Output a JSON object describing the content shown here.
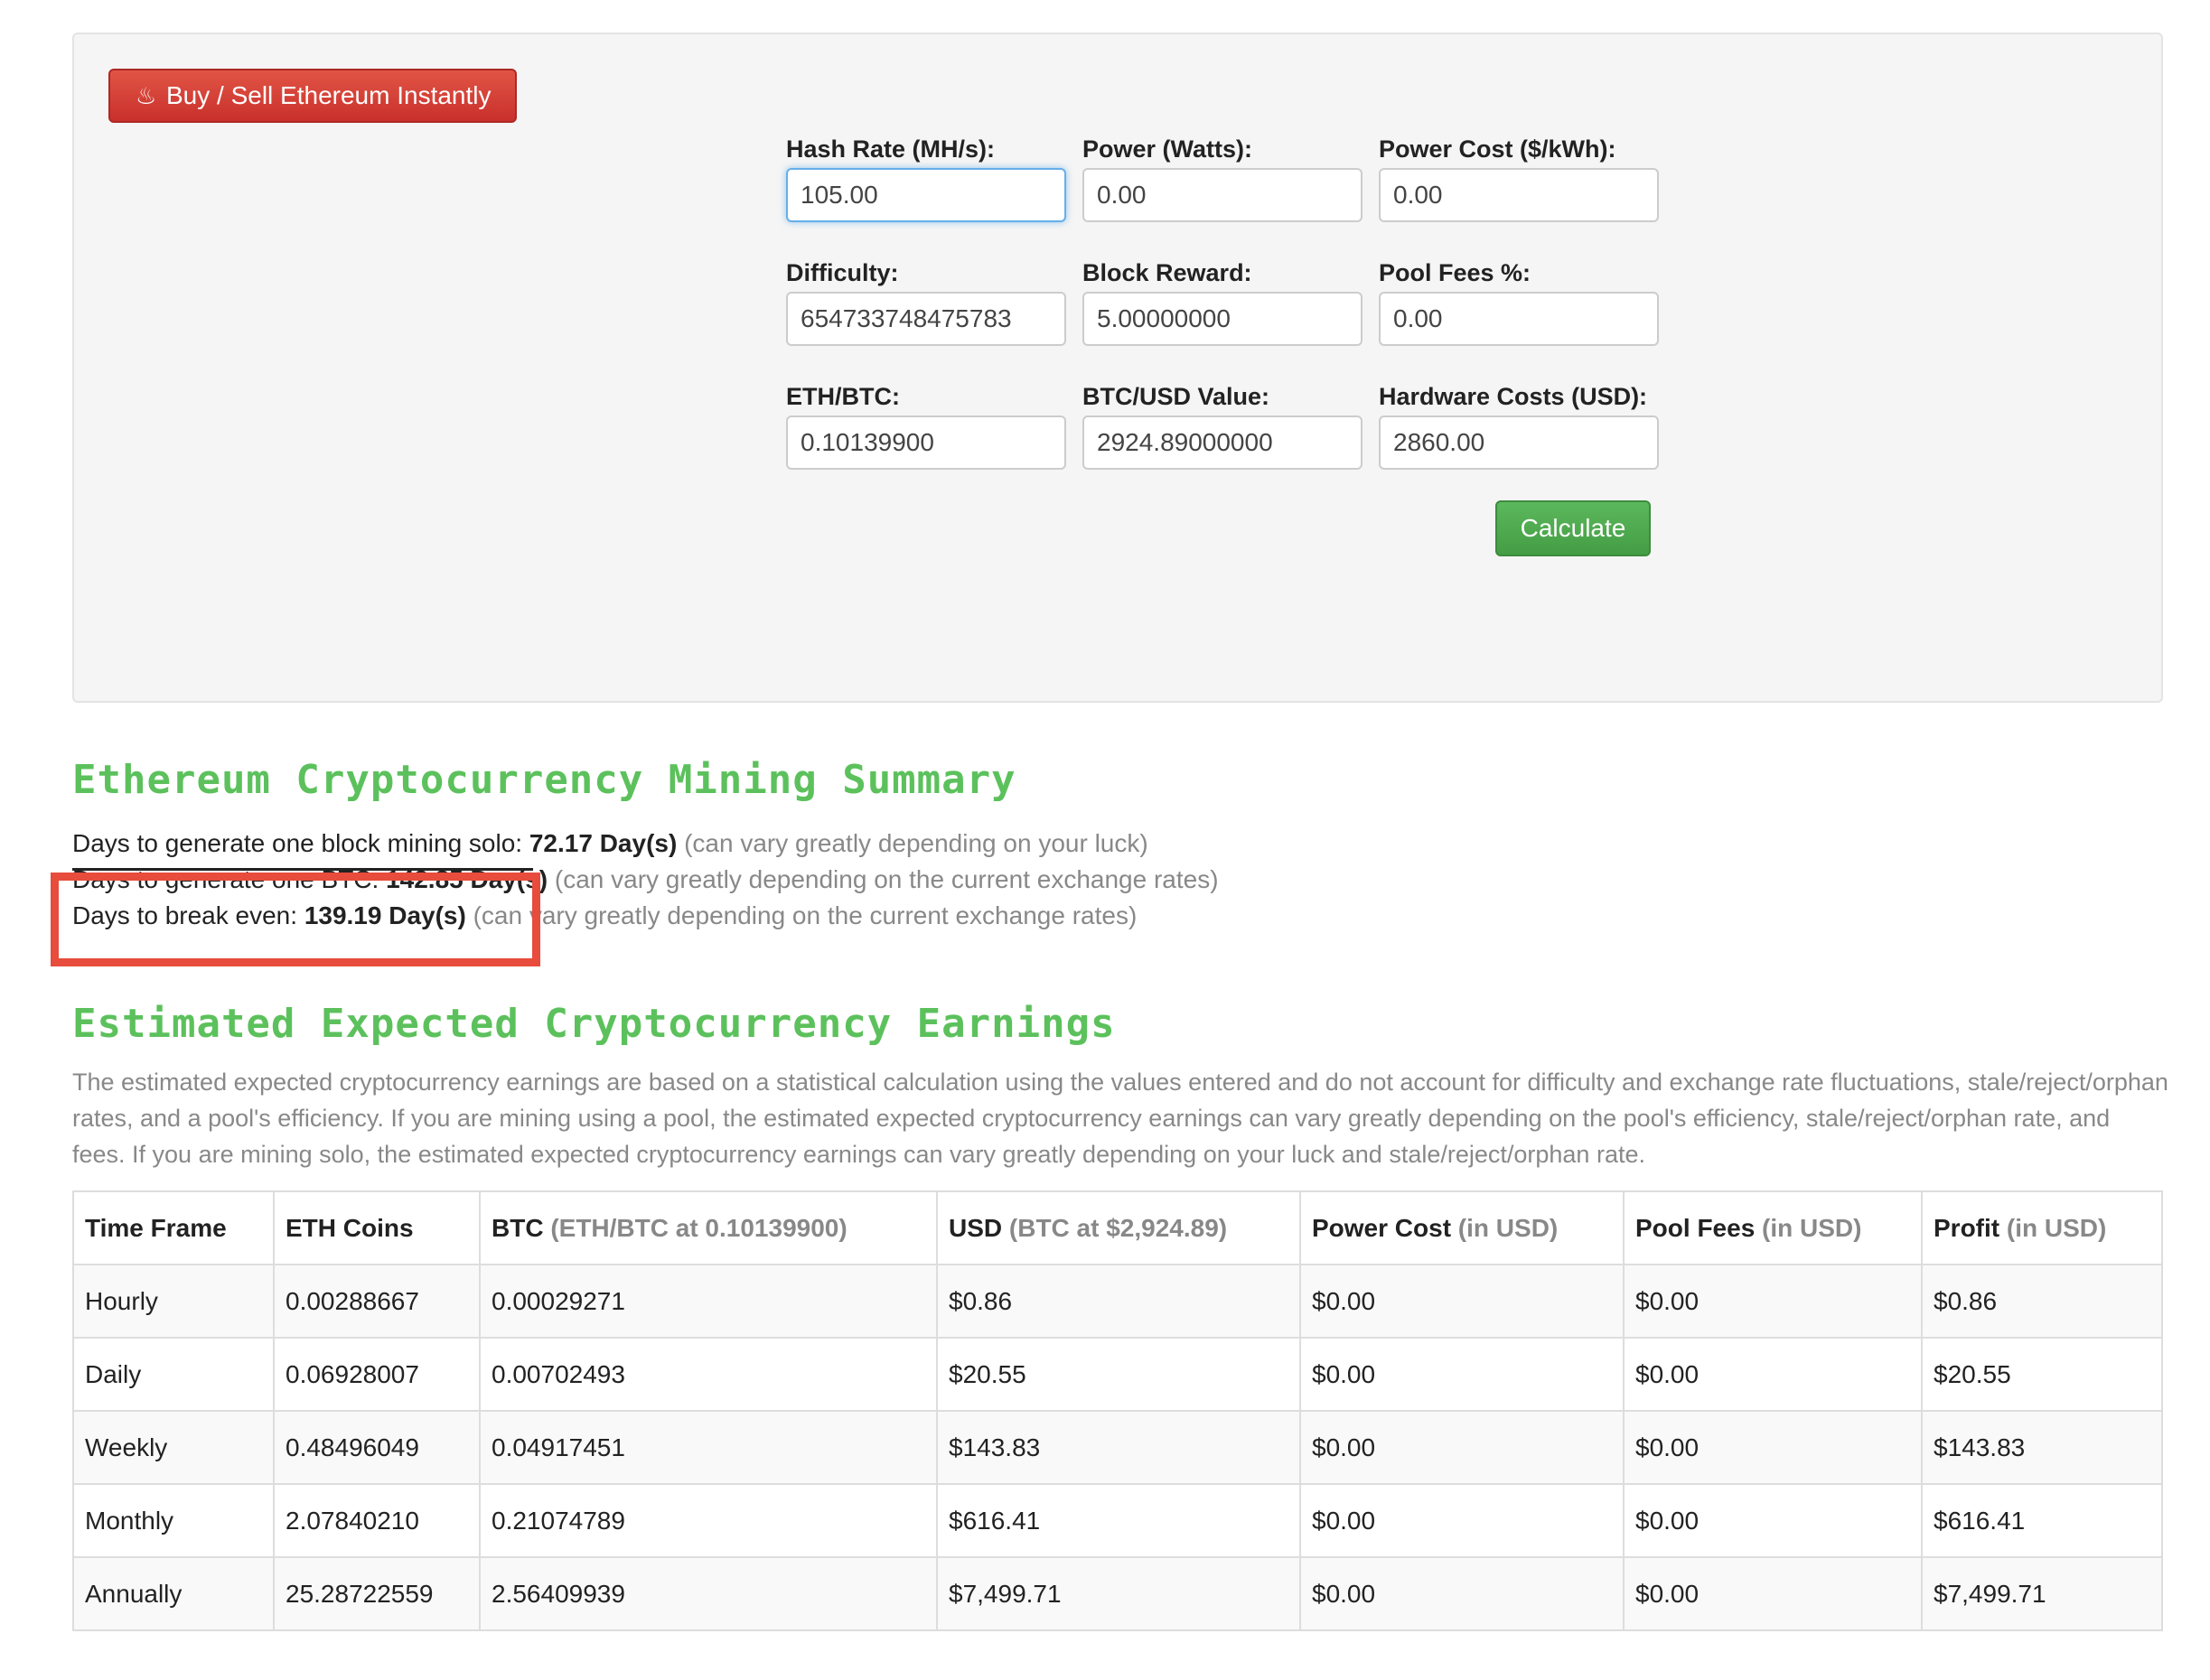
{
  "buy_button": {
    "label": "Buy / Sell Ethereum Instantly",
    "icon": "fire-icon"
  },
  "form": {
    "hash_rate": {
      "label": "Hash Rate (MH/s):",
      "value": "105.00"
    },
    "power": {
      "label": "Power (Watts):",
      "value": "0.00"
    },
    "power_cost": {
      "label": "Power Cost ($/kWh):",
      "value": "0.00"
    },
    "difficulty": {
      "label": "Difficulty:",
      "value": "654733748475783"
    },
    "block_reward": {
      "label": "Block Reward:",
      "value": "5.00000000"
    },
    "pool_fees": {
      "label": "Pool Fees %:",
      "value": "0.00"
    },
    "eth_btc": {
      "label": "ETH/BTC:",
      "value": "0.10139900"
    },
    "btc_usd": {
      "label": "BTC/USD Value:",
      "value": "2924.89000000"
    },
    "hardware_costs": {
      "label": "Hardware Costs (USD):",
      "value": "2860.00"
    },
    "calculate_label": "Calculate"
  },
  "summary": {
    "title": "Ethereum Cryptocurrency Mining Summary",
    "line1": {
      "prefix": "Days to generate one block mining solo: ",
      "value": "72.17 Day(s)",
      "note": " (can vary greatly depending on your luck)"
    },
    "line2": {
      "prefix": "Days to generate one BTC: ",
      "value": "142.85 Day(s)",
      "note": " (can vary greatly depending on the current exchange rates)"
    },
    "line3": {
      "prefix": "Days to break even: ",
      "value": "139.19 Day(s)",
      "note": " (can vary greatly depending on the current exchange rates)"
    }
  },
  "earnings": {
    "title": "Estimated Expected Cryptocurrency Earnings",
    "description": "The estimated expected cryptocurrency earnings are based on a statistical calculation using the values entered and do not account for difficulty and exchange rate fluctuations, stale/reject/orphan rates, and a pool's efficiency. If you are mining using a pool, the estimated expected cryptocurrency earnings can vary greatly depending on the pool's efficiency, stale/reject/orphan rate, and fees. If you are mining solo, the estimated expected cryptocurrency earnings can vary greatly depending on your luck and stale/reject/orphan rate.",
    "headers": [
      {
        "main": "Time Frame",
        "sub": ""
      },
      {
        "main": "ETH Coins",
        "sub": ""
      },
      {
        "main": "BTC",
        "sub": " (ETH/BTC at 0.10139900)"
      },
      {
        "main": "USD",
        "sub": " (BTC at $2,924.89)"
      },
      {
        "main": "Power Cost",
        "sub": " (in USD)"
      },
      {
        "main": "Pool Fees",
        "sub": " (in USD)"
      },
      {
        "main": "Profit",
        "sub": " (in USD)"
      }
    ],
    "rows": [
      [
        "Hourly",
        "0.00288667",
        "0.00029271",
        "$0.86",
        "$0.00",
        "$0.00",
        "$0.86"
      ],
      [
        "Daily",
        "0.06928007",
        "0.00702493",
        "$20.55",
        "$0.00",
        "$0.00",
        "$20.55"
      ],
      [
        "Weekly",
        "0.48496049",
        "0.04917451",
        "$143.83",
        "$0.00",
        "$0.00",
        "$143.83"
      ],
      [
        "Monthly",
        "2.07840210",
        "0.21074789",
        "$616.41",
        "$0.00",
        "$0.00",
        "$616.41"
      ],
      [
        "Annually",
        "25.28722559",
        "2.56409939",
        "$7,499.71",
        "$0.00",
        "$0.00",
        "$7,499.71"
      ]
    ]
  },
  "colors": {
    "title_green": "#5cc15c",
    "buy_red": "#d9534f",
    "calc_green": "#5cb85c",
    "highlight_red": "#e74c3c"
  }
}
